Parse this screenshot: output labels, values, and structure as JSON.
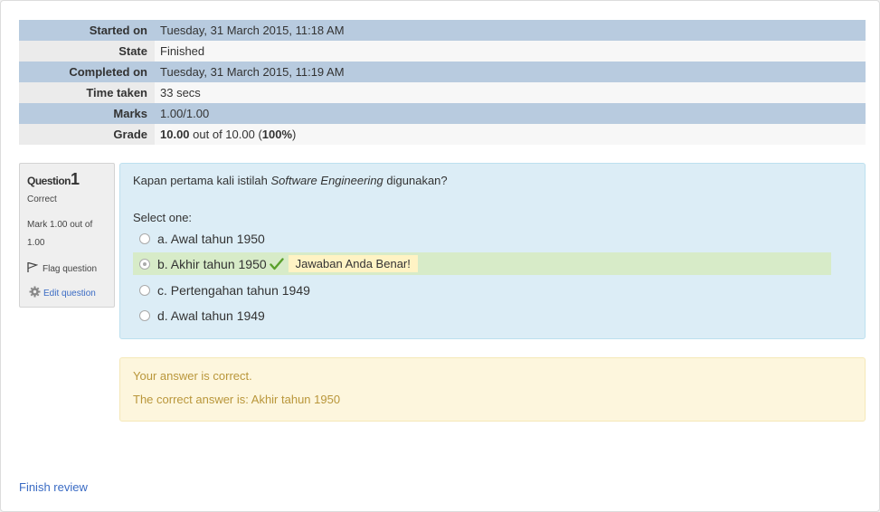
{
  "summary": {
    "rows": [
      {
        "label": "Started on",
        "value": "Tuesday, 31 March 2015, 11:18 AM"
      },
      {
        "label": "State",
        "value": "Finished"
      },
      {
        "label": "Completed on",
        "value": "Tuesday, 31 March 2015, 11:19 AM"
      },
      {
        "label": "Time taken",
        "value": "33 secs"
      },
      {
        "label": "Marks",
        "value": "1.00/1.00"
      }
    ],
    "grade": {
      "label": "Grade",
      "score": "10.00",
      "middle": " out of 10.00 (",
      "percent": "100%",
      "end": ")"
    }
  },
  "question": {
    "title_word": "Question",
    "number": "1",
    "state": "Correct",
    "grade_text": "Mark 1.00 out of 1.00",
    "flag_label": "Flag question",
    "edit_label": "Edit question",
    "text_before": "Kapan pertama kali istilah ",
    "text_italic": "Software Engineering",
    "text_after": " digunakan?",
    "prompt": "Select one:",
    "options": [
      {
        "label": "a. Awal tahun 1950"
      },
      {
        "label": "b. Akhir tahun 1950",
        "feedback": "Jawaban Anda Benar!"
      },
      {
        "label": "c. Pertengahan tahun 1949"
      },
      {
        "label": "d. Awal tahun 1949"
      }
    ]
  },
  "outcome": {
    "line1": "Your answer is correct.",
    "line2": "The correct answer is: Akhir tahun 1950"
  },
  "footer": {
    "finish_label": "Finish review"
  },
  "colors": {
    "header_row": "#b8cbdf",
    "question_bg": "#dcedf6",
    "correct_bg": "#d7ebc8",
    "outcome_bg": "#fdf6dd",
    "link": "#3a6bc4"
  }
}
